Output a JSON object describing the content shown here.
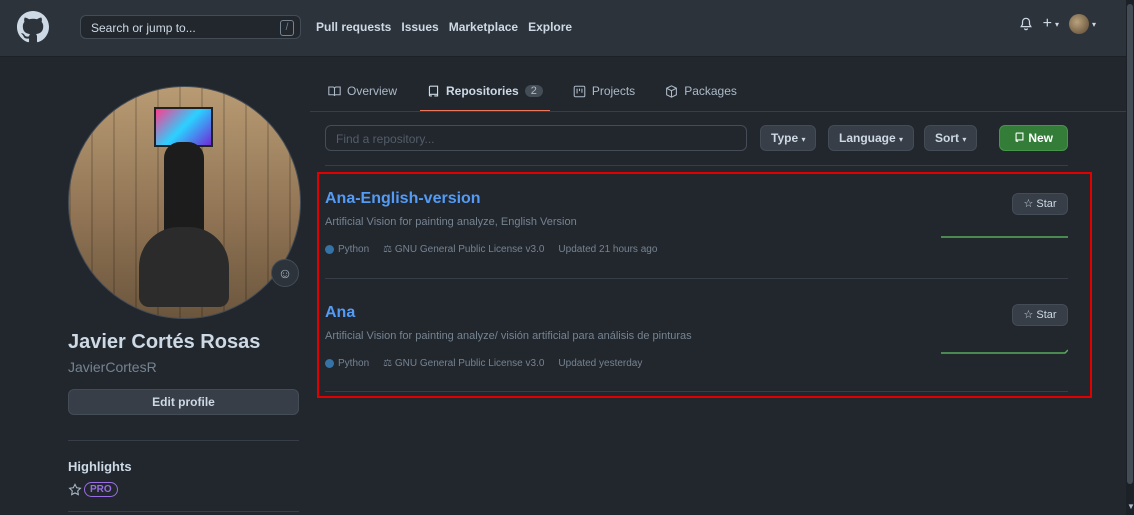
{
  "header": {
    "search_placeholder": "Search or jump to...",
    "search_shortcut": "/",
    "nav": [
      "Pull requests",
      "Issues",
      "Marketplace",
      "Explore"
    ]
  },
  "profile": {
    "name": "Javier Cortés Rosas",
    "login": "JavierCortesR",
    "edit_label": "Edit profile",
    "highlights_title": "Highlights",
    "pro_badge": "PRO"
  },
  "tabs": [
    {
      "label": "Overview",
      "icon": "book-icon"
    },
    {
      "label": "Repositories",
      "icon": "repo-icon",
      "count": "2",
      "active": true
    },
    {
      "label": "Projects",
      "icon": "project-icon"
    },
    {
      "label": "Packages",
      "icon": "package-icon"
    }
  ],
  "filters": {
    "find_placeholder": "Find a repository...",
    "type_label": "Type",
    "language_label": "Language",
    "sort_label": "Sort",
    "new_label": "New"
  },
  "repos": [
    {
      "name": "Ana-English-version",
      "description": "Artificial Vision for painting analyze, English Version",
      "language": "Python",
      "license": "GNU General Public License v3.0",
      "updated": "Updated 21 hours ago",
      "star_label": "Star"
    },
    {
      "name": "Ana",
      "description": "Artificial Vision for painting analyze/ visión artificial para análisis de pinturas",
      "language": "Python",
      "license": "GNU General Public License v3.0",
      "updated": "Updated yesterday",
      "star_label": "Star"
    }
  ],
  "colors": {
    "accent_green": "#347d39",
    "link_blue": "#539bf5",
    "python_blue": "#3572A5",
    "tab_underline": "#ec775c",
    "highlight_red": "#e00000"
  }
}
